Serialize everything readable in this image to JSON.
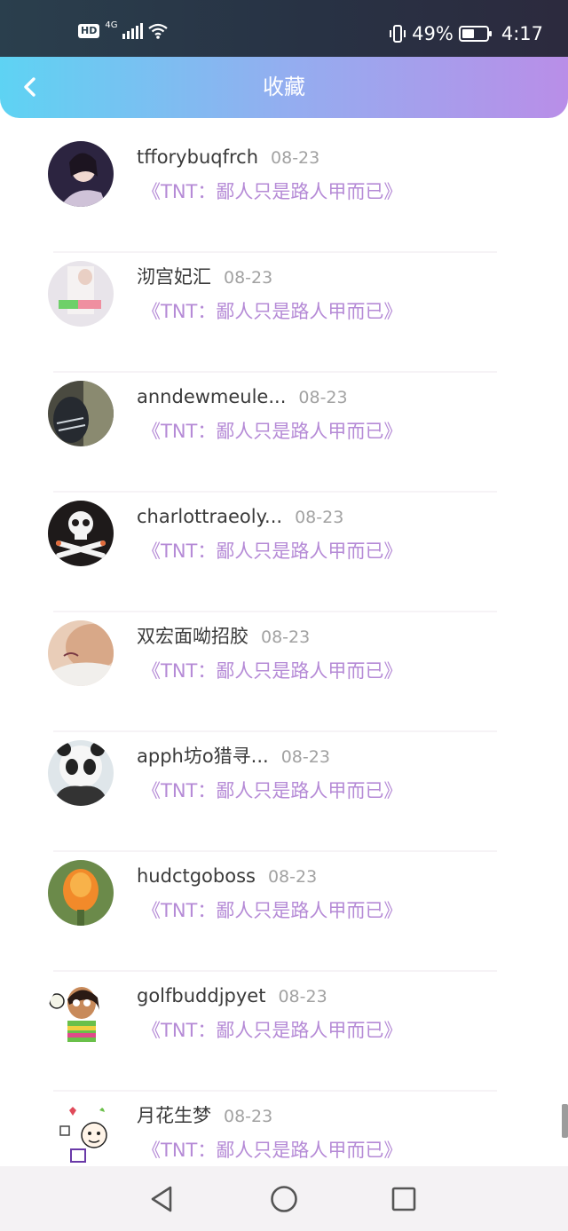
{
  "status_bar": {
    "hd": "HD",
    "network": "4G",
    "battery_percent": "49%",
    "battery_level": 0.49,
    "time": "4:17"
  },
  "header": {
    "title": "收藏",
    "back_icon": "chevron-left-icon"
  },
  "favorites": [
    {
      "name": "tfforybuqfrch",
      "date": "08-23",
      "work": "《TNT：鄙人只是路人甲而已》"
    },
    {
      "name": "沏宫妃汇",
      "date": "08-23",
      "work": "《TNT：鄙人只是路人甲而已》"
    },
    {
      "name": "anndewmeule...",
      "date": "08-23",
      "work": "《TNT：鄙人只是路人甲而已》"
    },
    {
      "name": "charlottraeoly...",
      "date": "08-23",
      "work": "《TNT：鄙人只是路人甲而已》"
    },
    {
      "name": "双宏面呦招胶",
      "date": "08-23",
      "work": "《TNT：鄙人只是路人甲而已》"
    },
    {
      "name": "apph坊o猎寻...",
      "date": "08-23",
      "work": "《TNT：鄙人只是路人甲而已》"
    },
    {
      "name": "hudctgoboss",
      "date": "08-23",
      "work": "《TNT：鄙人只是路人甲而已》"
    },
    {
      "name": "golfbuddjpyet",
      "date": "08-23",
      "work": "《TNT：鄙人只是路人甲而已》"
    },
    {
      "name": "月花生梦",
      "date": "08-23",
      "work": "《TNT：鄙人只是路人甲而已》"
    }
  ],
  "nav_bar": {
    "back": "triangle-back-icon",
    "home": "circle-home-icon",
    "recents": "square-recents-icon"
  },
  "colors": {
    "header_gradient": [
      "#5ed3f3",
      "#93aef0",
      "#b98ee8"
    ],
    "work_title": "#b58ad6",
    "status_bar": "#283244"
  }
}
